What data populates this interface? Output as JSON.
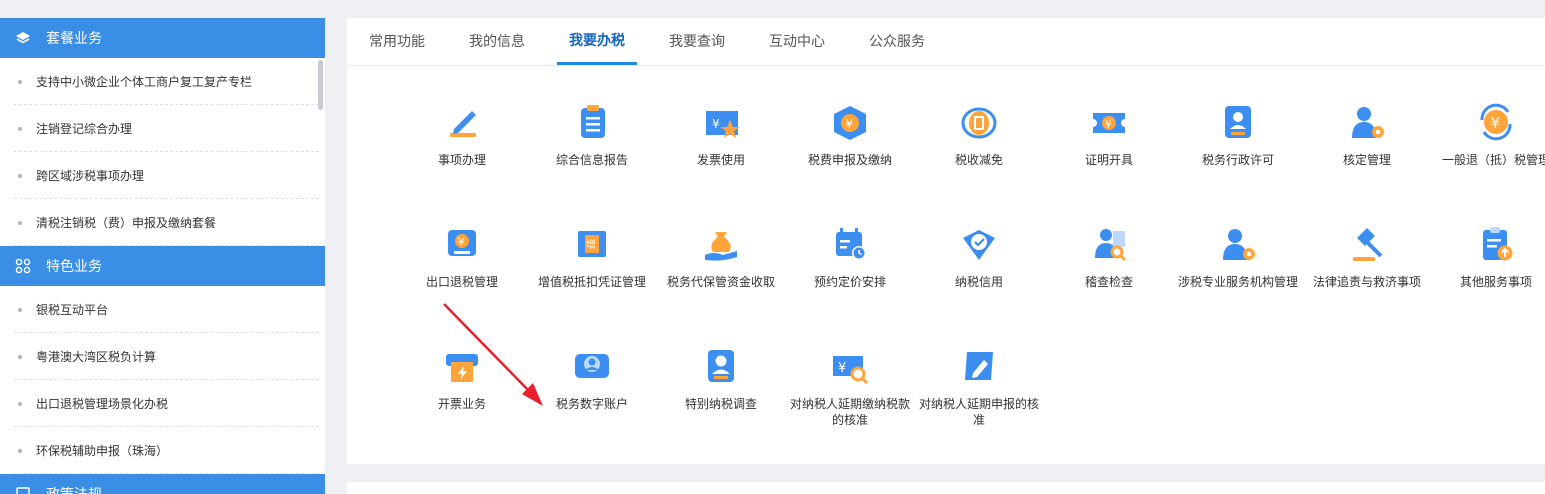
{
  "sidebar": {
    "sections": [
      {
        "title": "套餐业务",
        "items": [
          "支持中小微企业个体工商户复工复产专栏",
          "注销登记综合办理",
          "跨区域涉税事项办理",
          "清税注销税（费）申报及缴纳套餐"
        ]
      },
      {
        "title": "特色业务",
        "items": [
          "银税互动平台",
          "粤港澳大湾区税负计算",
          "出口退税管理场景化办税",
          "环保税辅助申报（珠海）"
        ]
      },
      {
        "title": "政策法规"
      }
    ]
  },
  "tabs": [
    "常用功能",
    "我的信息",
    "我要办税",
    "我要查询",
    "互动中心",
    "公众服务"
  ],
  "active_tab": "我要办税",
  "tiles": [
    "事项办理",
    "综合信息报告",
    "发票使用",
    "税费申报及缴纳",
    "税收减免",
    "证明开具",
    "税务行政许可",
    "核定管理",
    "一般退（抵）税管理",
    "出口退税管理",
    "增值税抵扣凭证管理",
    "税务代保管资金收取",
    "预约定价安排",
    "纳税信用",
    "稽查检查",
    "涉税专业服务机构管理",
    "法律追责与救济事项",
    "其他服务事项",
    "开票业务",
    "税务数字账户",
    "特别纳税调查",
    "对纳税人延期缴纳税款的核准",
    "对纳税人延期申报的核准"
  ],
  "icons": [
    "pen-icon",
    "document-list-icon",
    "invoice-star-icon",
    "tax-box-icon",
    "globe-emblem-icon",
    "ticket-icon",
    "license-person-icon",
    "person-gear-icon",
    "refund-cycle-icon",
    "export-box-icon",
    "vat-voucher-icon",
    "money-bag-hand-icon",
    "calendar-clock-icon",
    "shield-check-icon",
    "person-search-icon",
    "person-gear-icon",
    "gavel-icon",
    "clipboard-upload-icon",
    "invoice-printer-icon",
    "digital-account-icon",
    "person-card-icon",
    "ticket-search-icon",
    "pencil-card-icon"
  ],
  "colors": {
    "accent": "#3a8ee6",
    "tab_active": "#1565c0",
    "icon_blue": "#3c8ff0",
    "icon_orange": "#ffa43a",
    "arrow_red": "#e8202a"
  }
}
